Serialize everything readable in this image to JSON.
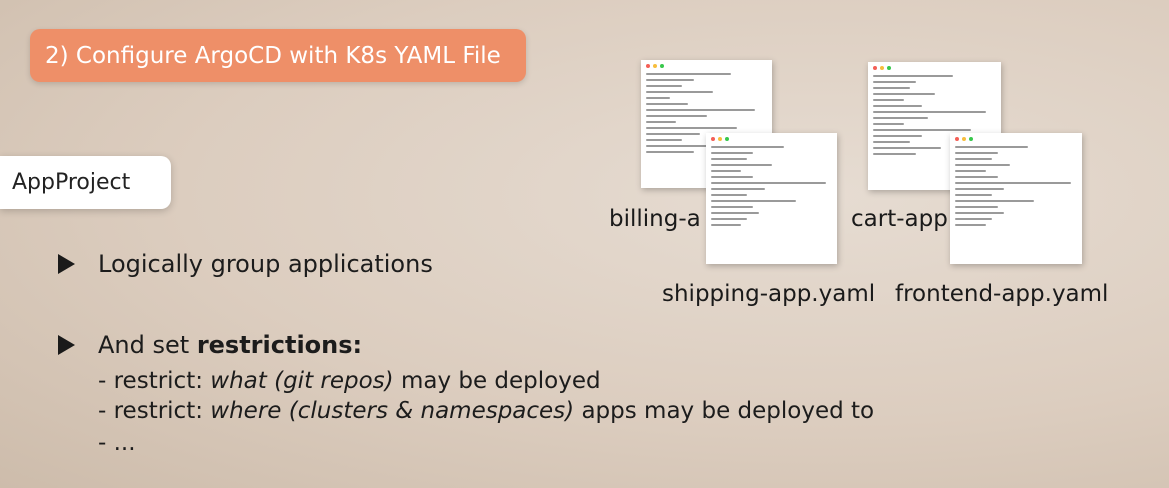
{
  "slide": {
    "title": "2) Configure ArgoCD with K8s YAML File",
    "tag": "AppProject",
    "bullet1": "Logically group applications",
    "bullet2_prefix": "And set ",
    "bullet2_bold": "restrictions:",
    "sub1_prefix": "- restrict: ",
    "sub1_italic": "what (git repos)",
    "sub1_suffix": " may be deployed",
    "sub2_prefix": "- restrict: ",
    "sub2_italic": "where (clusters & namespaces)",
    "sub2_suffix": " apps may be deployed to",
    "sub3": "-  ..."
  },
  "files": {
    "billing": "billing-a",
    "cart": "cart-app",
    "shipping": "shipping-app.yaml",
    "frontend": "frontend-app.yaml"
  },
  "colors": {
    "accent": "#ee8f68",
    "background": "#dccdbf"
  }
}
